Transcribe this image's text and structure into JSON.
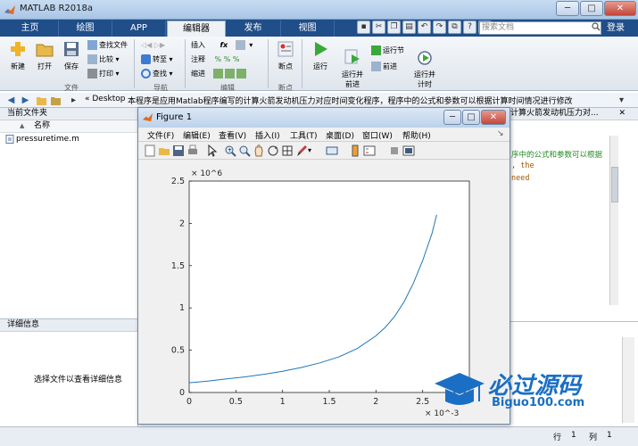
{
  "window": {
    "title": "MATLAB R2018a",
    "min": "─",
    "max": "□",
    "close": "✕"
  },
  "tabs": [
    "主页",
    "绘图",
    "APP",
    "编辑器",
    "发布",
    "视图"
  ],
  "search": {
    "placeholder": "搜索文档"
  },
  "login": "登录",
  "ribbon": {
    "file": {
      "new": "新建",
      "open": "打开",
      "save": "保存",
      "find_files": "查找文件",
      "compare": "比较",
      "print": "打印",
      "group": "文件"
    },
    "navigate": {
      "goto": "转至",
      "find": "查找",
      "group": "导航"
    },
    "edit": {
      "insert": "插入",
      "comment": "注释",
      "indent": "缩进",
      "fx": "fx",
      "group": "编辑"
    },
    "breakpoints": {
      "label": "断点",
      "group": "断点"
    },
    "run": {
      "run": "运行",
      "run_advance": "运行并\n前进",
      "run_section": "运行节",
      "advance": "前进",
      "run_time": "运行并\n计时",
      "group": "运行"
    }
  },
  "address": {
    "path": "« Desktop",
    "description": "本程序是应用Matlab程序编写的计算火箭发动机压力对应时间变化程序，程序中的公式和参数可以根据计算时间情况进行修改"
  },
  "current_folder": {
    "title": "当前文件夹",
    "col_name": "名称",
    "sort_arrow": "▲",
    "files": [
      "pressuretime.m"
    ]
  },
  "details": {
    "title": "详细信息",
    "message": "选择文件以查看详细信息"
  },
  "editor": {
    "tab_title": "计算火箭发动机压力对...",
    "lines": [
      "序中的公式和参数可以根据",
      ", the",
      "need"
    ]
  },
  "status": {
    "row_label": "行",
    "row_value": "1",
    "col_label": "列",
    "col_value": "1"
  },
  "figure": {
    "title": "Figure 1",
    "menu": [
      "文件(F)",
      "编辑(E)",
      "查看(V)",
      "插入(I)",
      "工具(T)",
      "桌面(D)",
      "窗口(W)",
      "帮助(H)"
    ]
  },
  "chart_data": {
    "type": "line",
    "title": "",
    "xlabel": "",
    "ylabel": "",
    "x_multiplier": "× 10^-3",
    "y_multiplier": "× 10^6",
    "xlim": [
      0,
      0.003
    ],
    "ylim": [
      0,
      2500000
    ],
    "x_ticks": [
      "0",
      "0.5",
      "1",
      "1.5",
      "2",
      "2.5"
    ],
    "y_ticks": [
      "0",
      "0.5",
      "1",
      "1.5",
      "2",
      "2.5"
    ],
    "series": [
      {
        "color": "#1f77b4",
        "x": [
          0,
          0.0002,
          0.0004,
          0.0006,
          0.0008,
          0.001,
          0.0012,
          0.0014,
          0.0016,
          0.0018,
          0.002,
          0.0021,
          0.0022,
          0.0023,
          0.0024,
          0.0025,
          0.0026,
          0.00265
        ],
        "y": [
          115000,
          135000,
          160000,
          185000,
          215000,
          250000,
          295000,
          350000,
          420000,
          520000,
          670000,
          770000,
          900000,
          1070000,
          1290000,
          1560000,
          1880000,
          2100000
        ]
      }
    ]
  },
  "watermark": {
    "text": "必过源码",
    "url": "Biguo100.com"
  },
  "colors": {
    "tabstrip": "#1f4e89",
    "line": "#1f77b4",
    "watermark": "#1a6fc4"
  }
}
